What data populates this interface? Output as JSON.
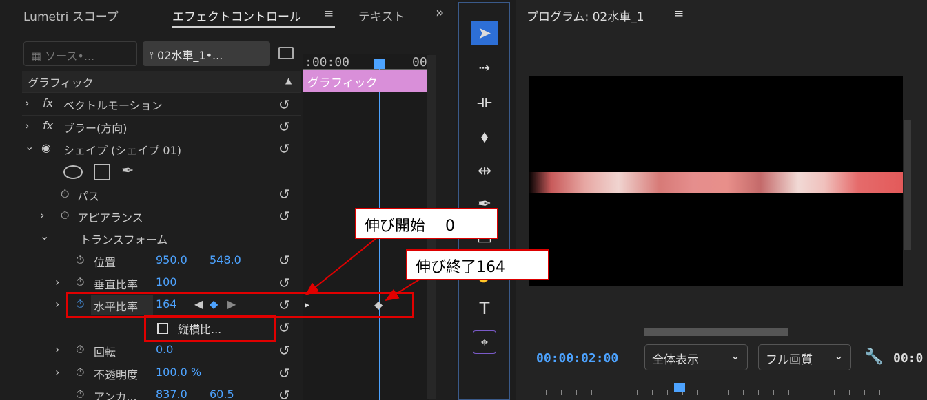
{
  "left_panel": {
    "tabs": [
      "Lumetri スコープ",
      "エフェクトコントロール",
      "テキスト"
    ],
    "tab_menu": "≡",
    "overflow": "»",
    "source_tab": "ソース•...",
    "sequence_tab": "02水車_1•...",
    "timecode_start": ":00:00",
    "timecode_end": "00",
    "clip_label": "グラフィック",
    "section": "グラフィック",
    "effects": [
      {
        "fx": "fx",
        "name": "ベクトルモーション"
      },
      {
        "fx": "fx",
        "name": "ブラー(方向)"
      }
    ],
    "shape": {
      "name": "シェイプ (シェイプ 01)"
    },
    "path_label": "パス",
    "appearance_label": "アピアランス",
    "transform_label": "トランスフォーム",
    "position": {
      "label": "位置",
      "x": "950.0",
      "y": "548.0"
    },
    "vscale": {
      "label": "垂直比率",
      "value": "100"
    },
    "hscale": {
      "label": "水平比率",
      "value": "164"
    },
    "aspect_label": "縦横比...",
    "rotation": {
      "label": "回転",
      "value": "0.0"
    },
    "opacity": {
      "label": "不透明度",
      "value": "100.0 %"
    },
    "anchor": {
      "label": "アンカ...",
      "x": "837.0",
      "y": "60.5"
    }
  },
  "monitor": {
    "title": "プログラム: 02水車_1",
    "menu": "≡",
    "timecode": "00:00:02:00",
    "zoom": "全体表示",
    "quality": "フル画質",
    "timecode_right": "00:0"
  },
  "annotations": {
    "start": "伸び開始　 0",
    "end": "伸び終了164"
  },
  "colors": {
    "accent": "#4da3ff",
    "clip": "#d98fd9",
    "highlight": "#e10000"
  }
}
